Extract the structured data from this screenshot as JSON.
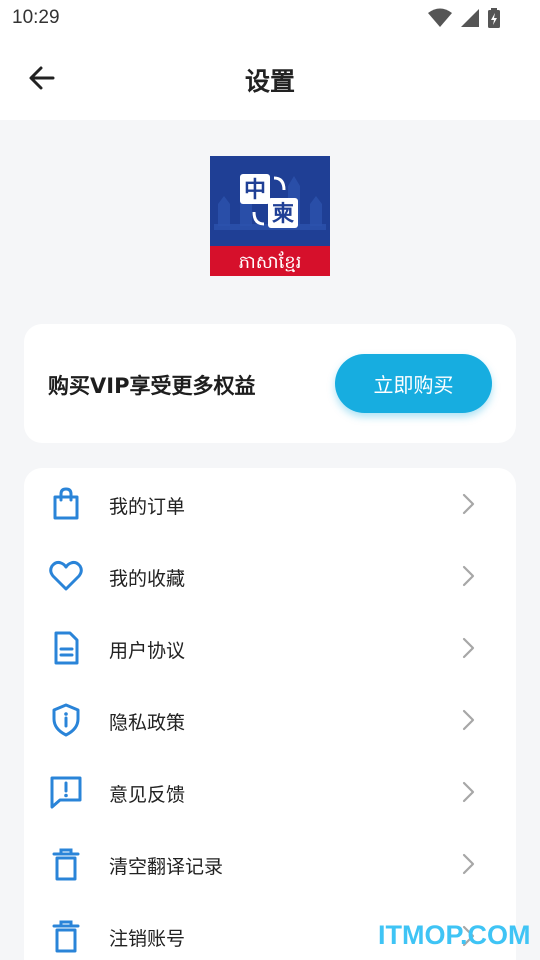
{
  "status_bar": {
    "time": "10:29"
  },
  "header": {
    "title": "设置"
  },
  "logo": {
    "chinese_char_1": "中",
    "chinese_char_2": "柬",
    "khmer_text": "ភាសាខ្មែរ",
    "brand_color": "#1f3f95",
    "accent_color": "#d6102b"
  },
  "vip": {
    "promo_text": "购买VIP享受更多权益",
    "buy_label": "立即购买",
    "button_color": "#17ade0"
  },
  "menu": {
    "icon_color": "#2a84d8",
    "items": [
      {
        "icon": "shopping-bag-icon",
        "label": "我的订单"
      },
      {
        "icon": "heart-icon",
        "label": "我的收藏"
      },
      {
        "icon": "document-icon",
        "label": "用户协议"
      },
      {
        "icon": "shield-icon",
        "label": "隐私政策"
      },
      {
        "icon": "feedback-icon",
        "label": "意见反馈"
      },
      {
        "icon": "trash-icon",
        "label": "清空翻译记录"
      },
      {
        "icon": "trash-icon",
        "label": "注销账号"
      }
    ]
  },
  "watermark": {
    "text": "ITMOP.COM"
  }
}
